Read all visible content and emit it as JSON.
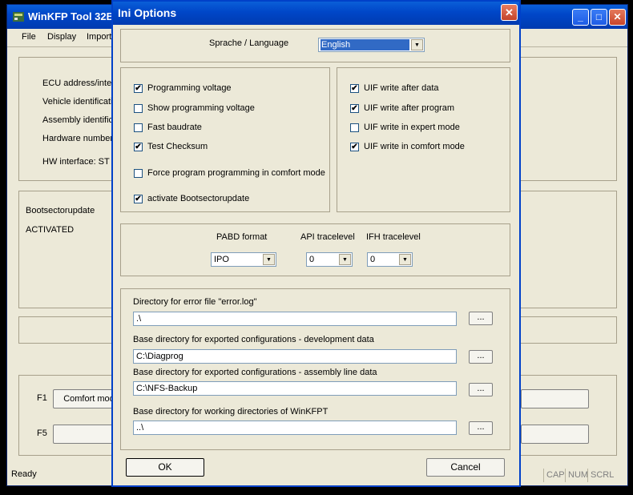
{
  "main_window": {
    "title": "WinKFP Tool 32B",
    "menu": [
      "File",
      "Display",
      "Import"
    ],
    "info_labels": [
      "ECU address/integ",
      "Vehicle identificati",
      "Assembly identifica",
      "Hardware number",
      "HW interface:  ST"
    ],
    "boot_label": "Bootsectorupdate",
    "boot_status": "ACTIVATED",
    "f1_label": "F1",
    "f1_button": "Comfort mod",
    "f5_label": "F5",
    "status_text": "Ready",
    "status_cells": [
      "CAP",
      "NUM",
      "SCRL"
    ]
  },
  "dialog": {
    "title": "Ini Options",
    "language_label": "Sprache / Language",
    "language_value": "English",
    "options_left": [
      {
        "label": "Programming voltage",
        "checked": "✔"
      },
      {
        "label": "Show programming voltage",
        "checked": ""
      },
      {
        "label": "Fast baudrate",
        "checked": ""
      },
      {
        "label": "Test Checksum",
        "checked": "✔"
      },
      {
        "label": "Force program programming in comfort mode",
        "checked": ""
      },
      {
        "label": "activate Bootsectorupdate",
        "checked": "✔"
      }
    ],
    "options_right": [
      {
        "label": "UIF write after data",
        "checked": "✔"
      },
      {
        "label": "UIF write after program",
        "checked": "✔"
      },
      {
        "label": "UIF write in expert mode",
        "checked": ""
      },
      {
        "label": "UIF write in comfort mode",
        "checked": "✔"
      }
    ],
    "pabd_label": "PABD format",
    "pabd_value": "IPO",
    "api_label": "API tracelevel",
    "api_value": "0",
    "ifh_label": "IFH tracelevel",
    "ifh_value": "0",
    "dirs": [
      {
        "label": "Directory for error file \"error.log\"",
        "value": ".\\"
      },
      {
        "label": "Base directory for exported configurations - development data",
        "value": "C:\\Diagprog"
      },
      {
        "label": "Base directory for exported configurations - assembly line data",
        "value": "C:\\NFS-Backup"
      },
      {
        "label": "Base directory for working directories of WinKFPT",
        "value": "..\\"
      }
    ],
    "browse_label": "...",
    "ok_label": "OK",
    "cancel_label": "Cancel"
  }
}
